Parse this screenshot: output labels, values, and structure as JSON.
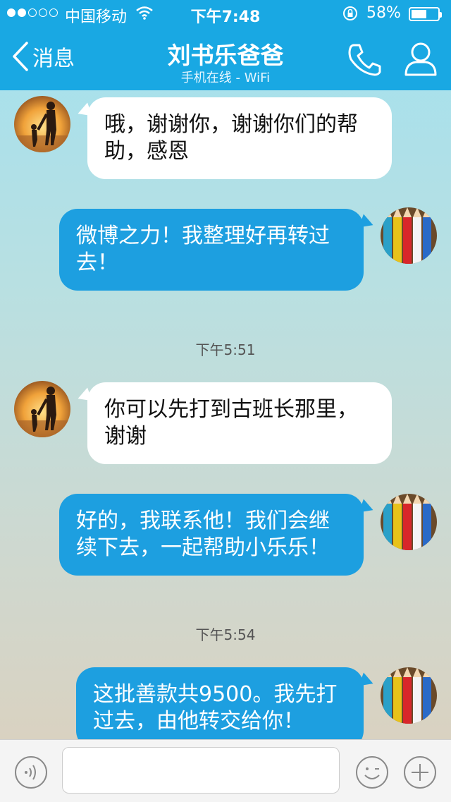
{
  "status_bar": {
    "carrier": "中国移动",
    "time": "下午7:48",
    "battery": "58%",
    "battery_level": 0.58
  },
  "nav": {
    "back_label": "消息",
    "title": "刘书乐爸爸",
    "subtitle": "手机在线 - WiFi"
  },
  "messages": [
    {
      "from": "contact",
      "text": "哦，谢谢你，谢谢你们的帮\n助，感恩"
    },
    {
      "from": "me",
      "text": "微博之力！我整理好再转过\n去！"
    },
    {
      "from": "contact",
      "text": "你可以先打到古班长那里，\n谢谢"
    },
    {
      "from": "me",
      "text": "好的，我联系他！我们会继\n续下去，一起帮助小乐乐！"
    },
    {
      "from": "me",
      "text": "这批善款共9500。我先打\n过去，由他转交给你！"
    }
  ],
  "timestamps": [
    "下午5:51",
    "下午5:54"
  ],
  "icons": {
    "back": "chevron-left-icon",
    "phone": "phone-icon",
    "profile": "person-icon",
    "voice": "voice-icon",
    "emoji": "smiley-icon",
    "plus": "plus-icon"
  },
  "colors": {
    "header": "#19a8e3",
    "outgoing_bubble": "#1d9fe0",
    "incoming_bubble": "#ffffff"
  }
}
